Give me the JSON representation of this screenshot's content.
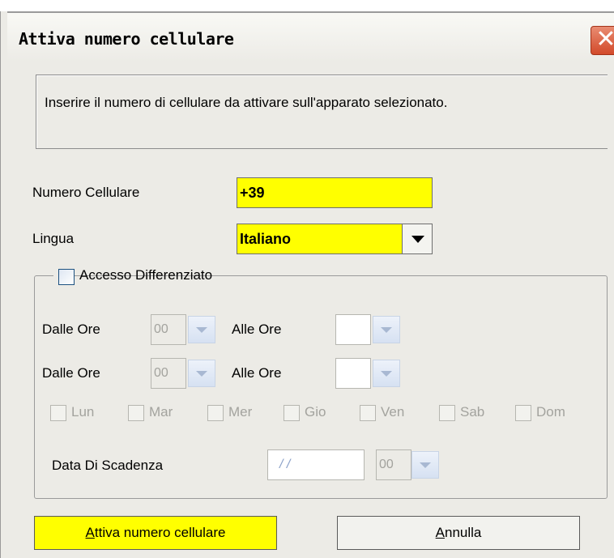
{
  "window": {
    "title": "Attiva numero cellulare",
    "close_icon": "close-icon"
  },
  "info": {
    "text": "Inserire il numero di cellulare da attivare sull'apparato selezionato."
  },
  "form": {
    "numero_label": "Numero Cellulare",
    "numero_value": "+39",
    "lingua_label": "Lingua",
    "lingua_value": "Italiano",
    "accent_color": "#ffff00"
  },
  "accesso": {
    "checkbox_label": "Accesso Differenziato",
    "checked": false,
    "rows": [
      {
        "from_label": "Dalle Ore",
        "from_value": "00",
        "to_label": "Alle Ore",
        "to_value": ""
      },
      {
        "from_label": "Dalle Ore",
        "from_value": "00",
        "to_label": "Alle Ore",
        "to_value": ""
      }
    ],
    "days": [
      "Lun",
      "Mar",
      "Mer",
      "Gio",
      "Ven",
      "Sab",
      "Dom"
    ],
    "scadenza_label": "Data Di Scadenza",
    "scadenza_date": "/ /",
    "scadenza_hour": "00"
  },
  "buttons": {
    "attiva_mnemonic": "A",
    "attiva_rest": "ttiva numero cellulare",
    "annulla_mnemonic": "A",
    "annulla_rest": "nnulla"
  }
}
